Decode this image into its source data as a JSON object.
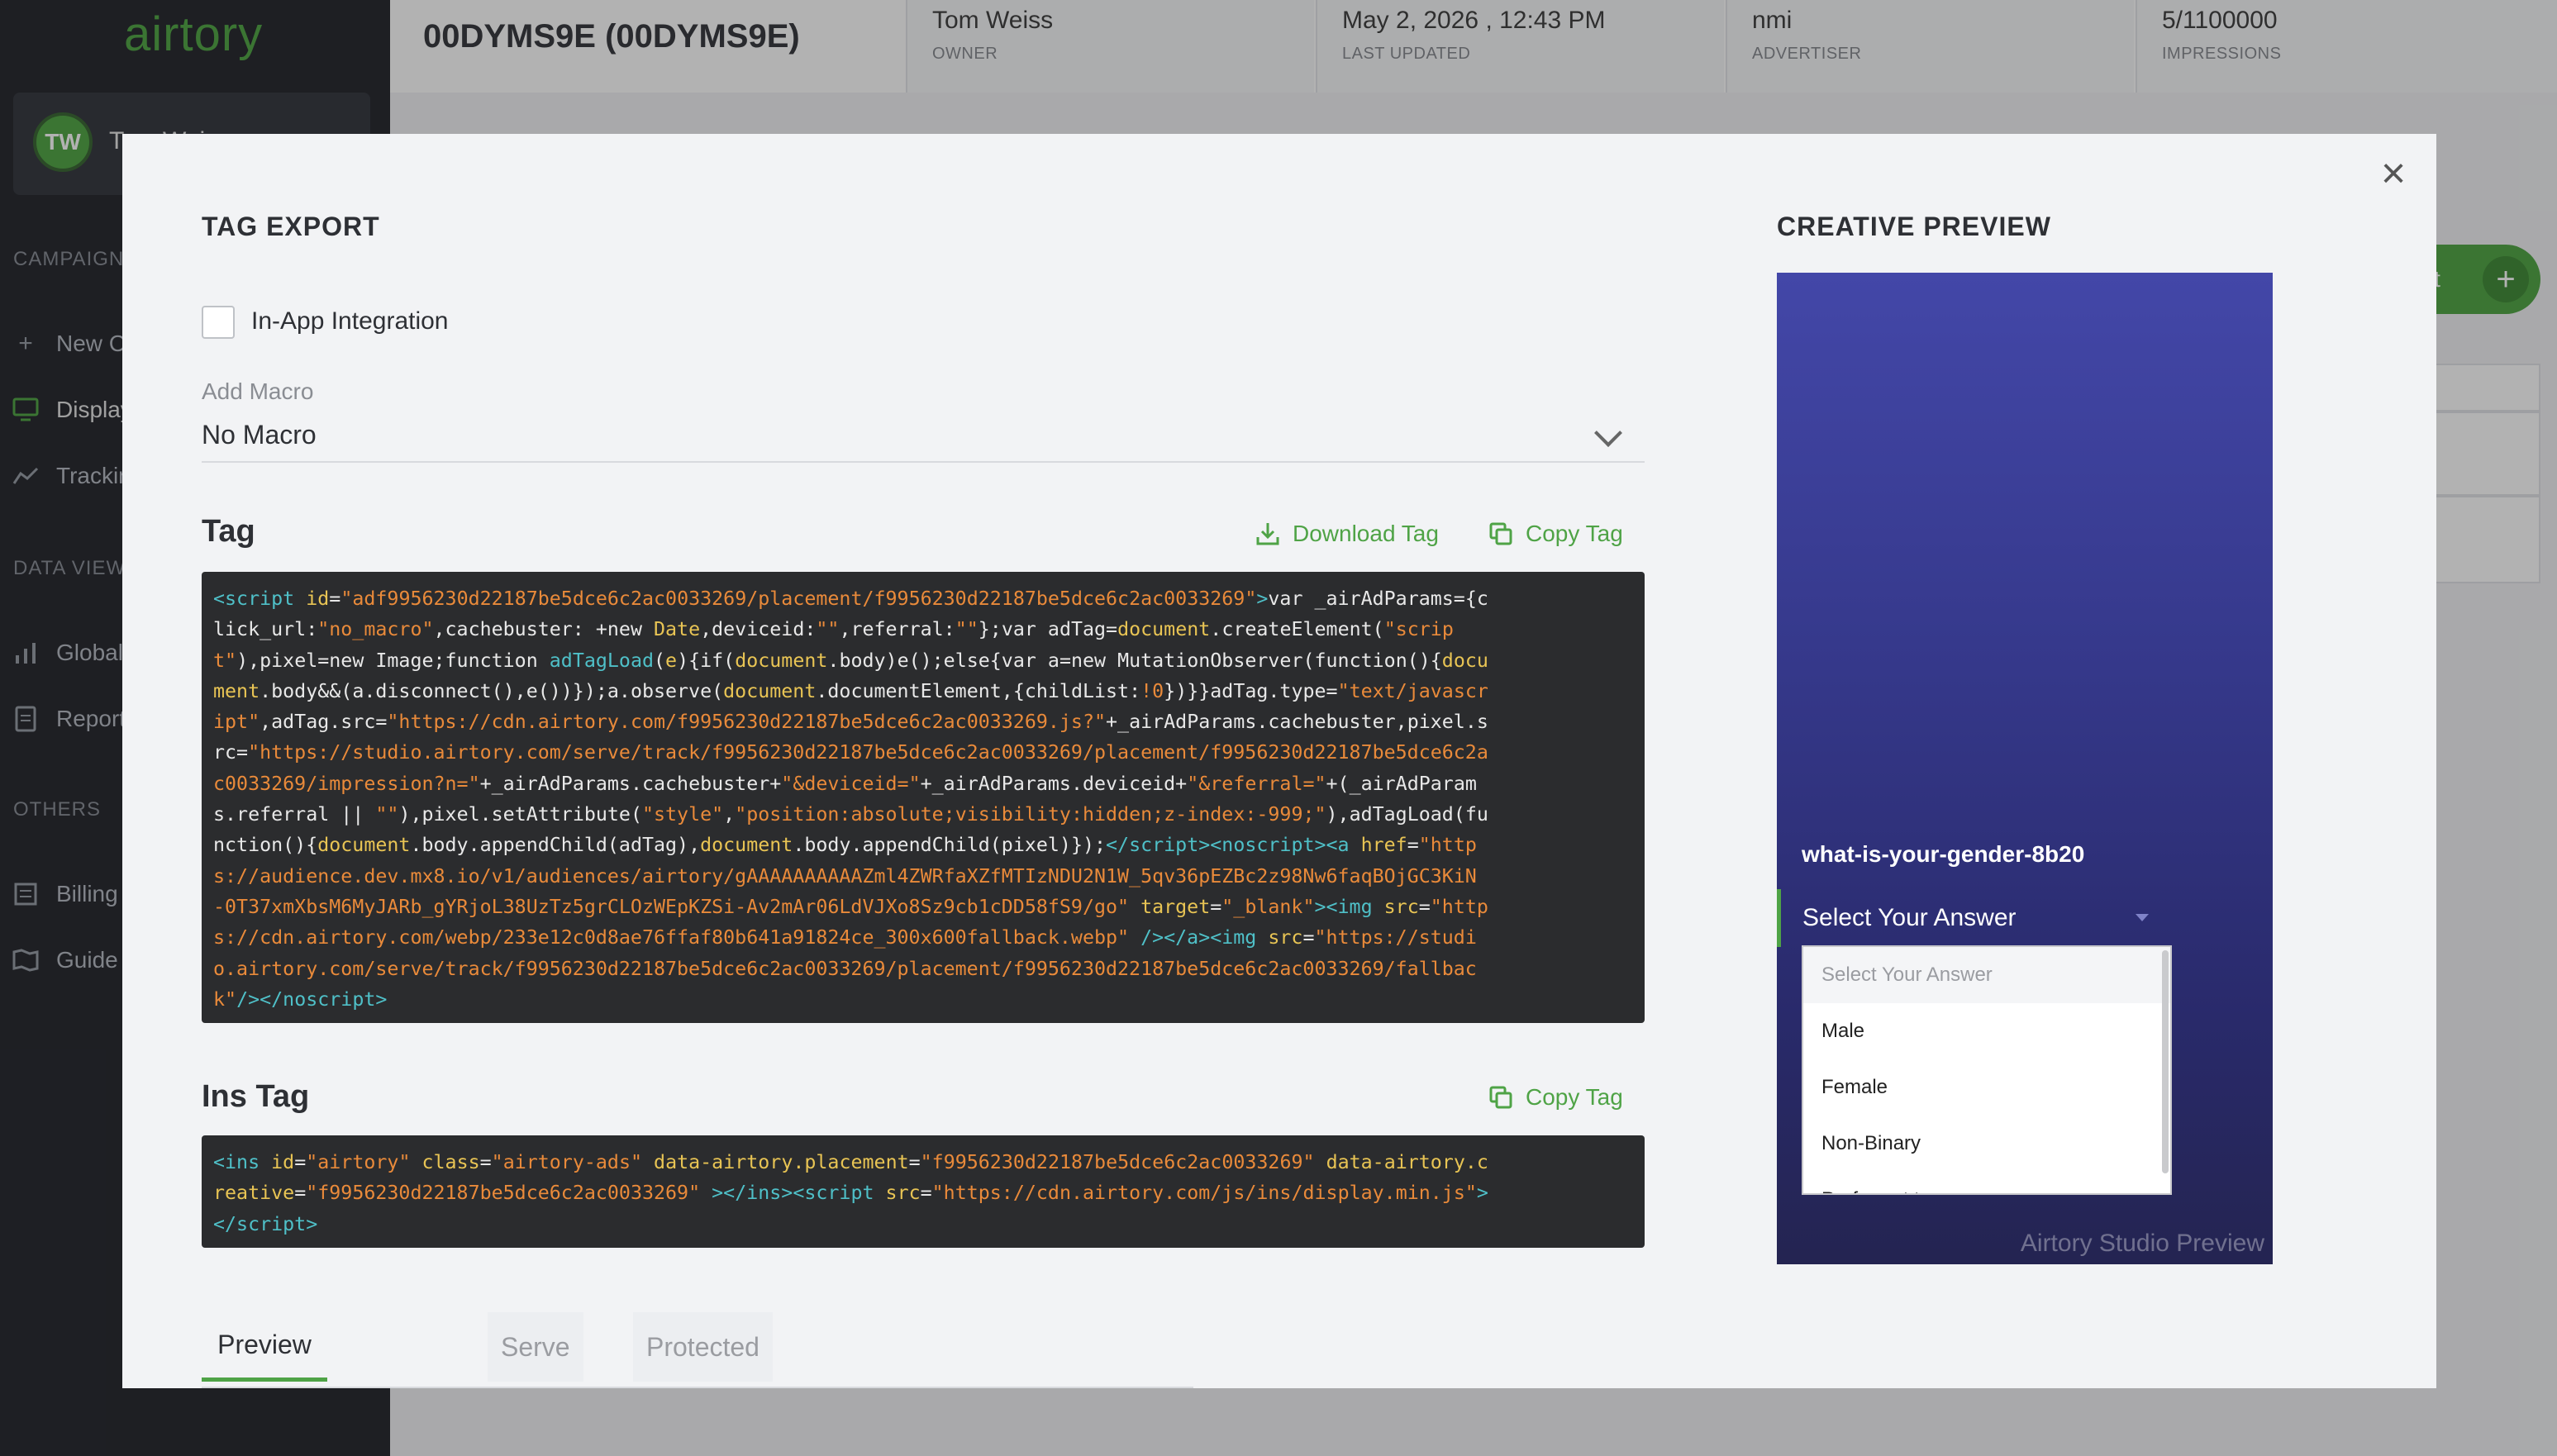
{
  "app": {
    "logo": "airtory",
    "user_initials": "TW",
    "user_name": "Tom Weiss"
  },
  "sidebar": {
    "sections": [
      {
        "title": "CAMPAIGN",
        "items": [
          "New Campaign",
          "Display",
          "Tracking"
        ]
      },
      {
        "title": "DATA VIEW",
        "items": [
          "Global",
          "Reports"
        ]
      },
      {
        "title": "OTHERS",
        "items": [
          "Billing",
          "Guide"
        ]
      }
    ]
  },
  "header": {
    "campaign_title": "00DYMS9E (00DYMS9E)",
    "info": [
      {
        "value": "Tom Weiss",
        "label": "OWNER"
      },
      {
        "value": "May 2, 2026 , 12:43 PM",
        "label": "LAST UPDATED"
      },
      {
        "value": "nmi",
        "label": "ADVERTISER"
      },
      {
        "value": "5/1100000",
        "label": "IMPRESSIONS"
      }
    ],
    "bg_button_label": "ent"
  },
  "modal": {
    "title": "TAG EXPORT",
    "in_app_label": "In-App Integration",
    "in_app_checked": false,
    "macro_label": "Add Macro",
    "macro_value": "No Macro",
    "tag_heading": "Tag",
    "download_tag": "Download Tag",
    "copy_tag": "Copy Tag",
    "ins_heading": "Ins Tag",
    "tabs": [
      "Preview",
      "Serve",
      "Protected"
    ],
    "active_tab": "Preview"
  },
  "preview": {
    "title": "CREATIVE PREVIEW",
    "question": "what-is-your-gender-8b20",
    "select_text": "Select Your Answer",
    "options": [
      "Select Your Answer",
      "Male",
      "Female",
      "Non-Binary",
      "Prefer not to say"
    ],
    "watermark": "Airtory Studio Preview"
  },
  "colors": {
    "accent": "#4fa346",
    "sidebar_bg": "#2b2d33",
    "code_bg": "#2b2c2e",
    "code_tag": "#4fc0c8",
    "code_attr": "#e8c454",
    "code_string": "#e98a3a"
  },
  "icons": {
    "download": "download-icon",
    "copy": "copy-icon",
    "close": "close-icon",
    "chevron": "chevron-down-icon"
  }
}
